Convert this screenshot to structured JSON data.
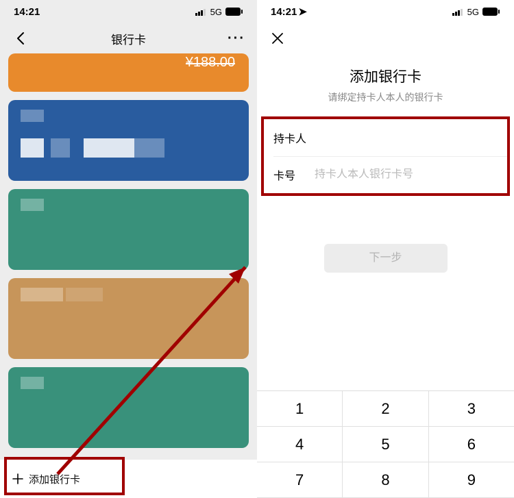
{
  "left": {
    "status_time": "14:21",
    "status_net": "5G",
    "nav_title": "银行卡",
    "card0_amount": "¥188.00",
    "add_label": "添加银行卡"
  },
  "right": {
    "status_time": "14:21",
    "status_net": "5G",
    "title": "添加银行卡",
    "subtitle": "请绑定持卡人本人的银行卡",
    "label_holder": "持卡人",
    "label_number": "卡号",
    "placeholder_number": "持卡人本人银行卡号",
    "next_label": "下一步",
    "keypad": [
      "1",
      "2",
      "3",
      "4",
      "5",
      "6",
      "7",
      "8",
      "9"
    ]
  }
}
